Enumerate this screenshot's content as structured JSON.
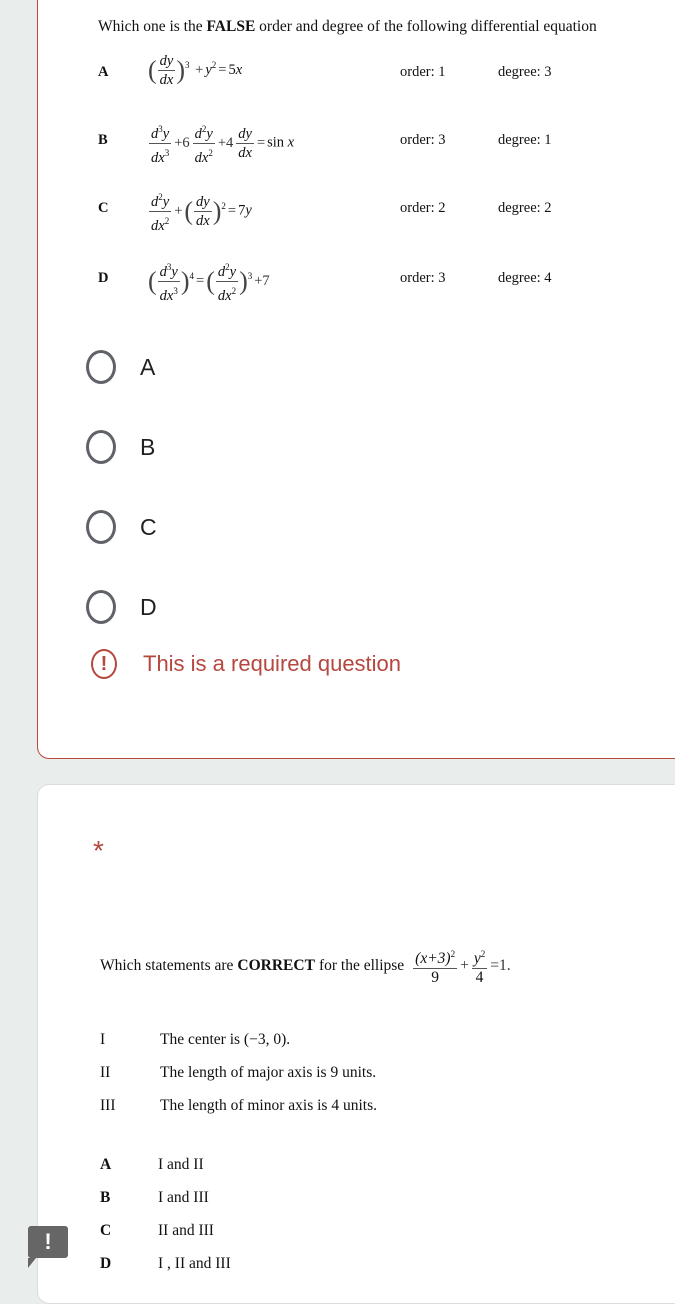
{
  "question1": {
    "title_pre": "Which one is the",
    "title_bold": "FALSE",
    "title_post": "order and degree of the following differential equation",
    "rows": [
      {
        "label": "A",
        "equation": "(dy/dx)^3 + y^2 = 5x",
        "order": "order: 1",
        "degree": "degree: 3"
      },
      {
        "label": "B",
        "equation": "d^3y/dx^3 + 6 d^2y/dx^2 + 4 dy/dx = sin x",
        "order": "order: 3",
        "degree": "degree: 1"
      },
      {
        "label": "C",
        "equation": "d^2y/dx^2 + (dy/dx)^2 = 7y",
        "order": "order: 2",
        "degree": "degree: 2"
      },
      {
        "label": "D",
        "equation": "(d^3y/dx^3)^4 = (d^2y/dx^2)^3 + 7",
        "order": "order: 3",
        "degree": "degree: 4"
      }
    ],
    "options": [
      "A",
      "B",
      "C",
      "D"
    ],
    "error_text": "This is a required question",
    "error_color": "#b5473f"
  },
  "question2": {
    "required_mark": "*",
    "title_pre": "Which statements are",
    "title_bold": "CORRECT",
    "title_post": "for the ellipse",
    "equation": "(x+3)^2/9 + y^2/4 = 1.",
    "statements": [
      {
        "num": "I",
        "text": "The center is (−3, 0)."
      },
      {
        "num": "II",
        "text": "The length of major axis is 9 units."
      },
      {
        "num": "III",
        "text": "The length of minor axis is 4 units."
      }
    ],
    "choices": [
      {
        "label": "A",
        "text": "I and II"
      },
      {
        "label": "B",
        "text": "I and III"
      },
      {
        "label": "C",
        "text": "II and III"
      },
      {
        "label": "D",
        "text": "I , II and III"
      }
    ]
  },
  "feedback_badge": "!"
}
